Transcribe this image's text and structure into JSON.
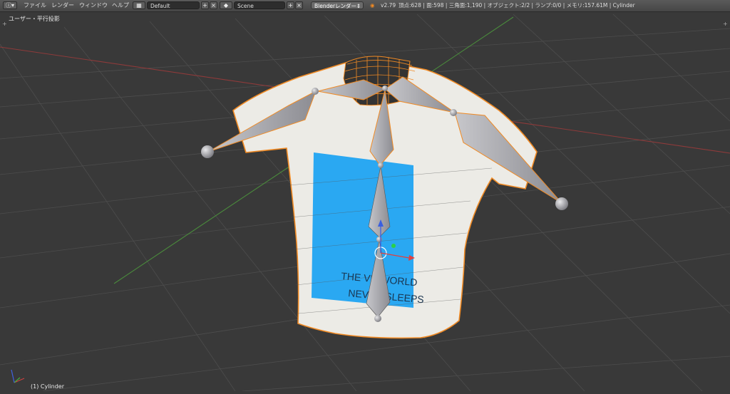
{
  "header": {
    "menus": [
      "ファイル",
      "レンダー",
      "ウィンドウ",
      "ヘルプ"
    ],
    "screen_layout": "Default",
    "scene": "Scene",
    "render_engine": "Blenderレンダー",
    "version": "v2.79",
    "stats": "頂点:628 | 面:598 | 三角面:1,190 | オブジェクト:2/2 | ランプ:0/0 | メモリ:157.61M | Cylinder"
  },
  "viewport": {
    "view_label": "ユーザー・平行投影",
    "object_label": "(1) Cylinder",
    "shirt_text": [
      "THE VR WORLD",
      "NEVER SLEEPS"
    ]
  },
  "colors": {
    "background": "#393939",
    "grid": "#4a4a4a",
    "x_axis": "#9a3b3b",
    "y_axis": "#4a8a3c",
    "selection": "#f08a24",
    "print": "#2aa8f2",
    "shirt": "#ecebe6",
    "bone": "#a4a4a8"
  },
  "icons": [
    "info-icon",
    "screen-layout-icon",
    "scene-icon",
    "blender-logo-icon",
    "axis-gizmo-icon"
  ]
}
